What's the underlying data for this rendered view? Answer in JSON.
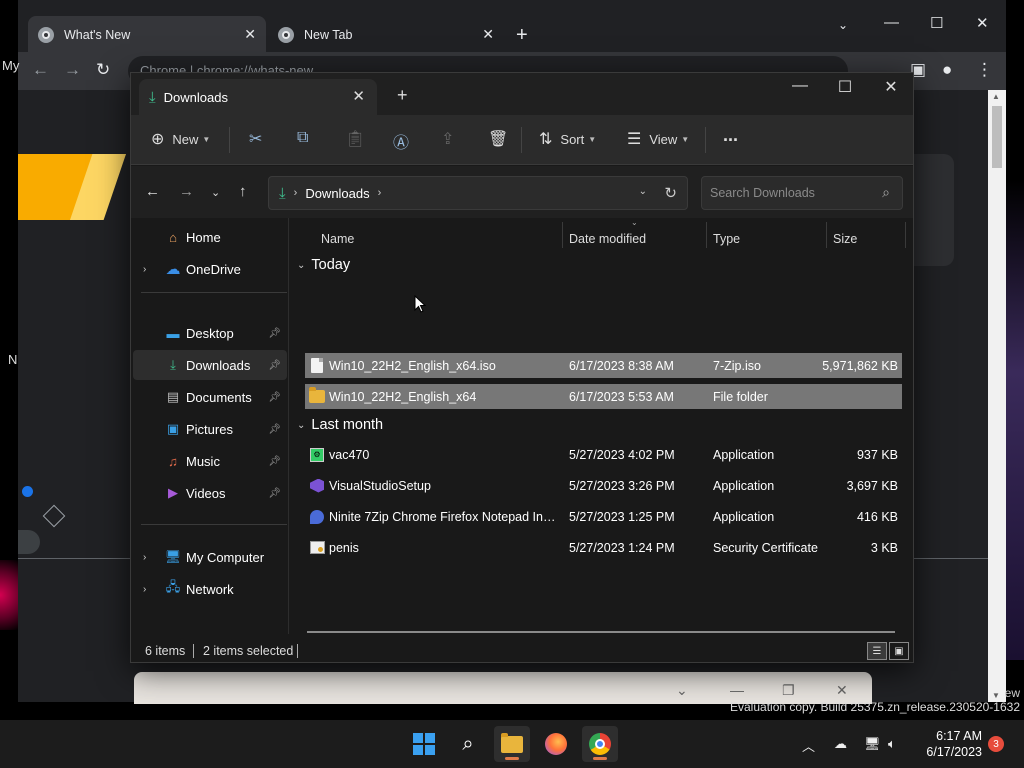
{
  "chrome": {
    "tabs": [
      {
        "label": "What's New"
      },
      {
        "label": "New Tab"
      }
    ],
    "omnibox": "Chrome  |  chrome://whats-new",
    "side_text_my": "My",
    "side_text_n": "N",
    "ew_text": "ew"
  },
  "explorer": {
    "tab_title": "Downloads",
    "commands": {
      "new": "New",
      "sort": "Sort",
      "view": "View",
      "more": "..."
    },
    "address": {
      "current": "Downloads"
    },
    "search_placeholder": "Search Downloads",
    "sidebar": [
      {
        "label": "Home",
        "icon": "home-icon"
      },
      {
        "label": "OneDrive",
        "icon": "onedrive-icon"
      },
      {
        "label": "Desktop",
        "icon": "desktop-icon"
      },
      {
        "label": "Downloads",
        "icon": "downloads-icon"
      },
      {
        "label": "Documents",
        "icon": "documents-icon"
      },
      {
        "label": "Pictures",
        "icon": "pictures-icon"
      },
      {
        "label": "Music",
        "icon": "music-icon"
      },
      {
        "label": "Videos",
        "icon": "videos-icon"
      },
      {
        "label": "My Computer",
        "icon": "computer-icon"
      },
      {
        "label": "Network",
        "icon": "network-icon"
      }
    ],
    "columns": {
      "name": "Name",
      "date": "Date modified",
      "type": "Type",
      "size": "Size"
    },
    "groups": [
      {
        "label": "Today",
        "rows": [
          {
            "name": "Win10_22H2_English_x64.iso",
            "date": "6/17/2023 8:38 AM",
            "type": "7-Zip.iso",
            "size": "5,971,862 KB",
            "icon": "iso-file-icon",
            "selected": true
          },
          {
            "name": "Win10_22H2_English_x64",
            "date": "6/17/2023 5:53 AM",
            "type": "File folder",
            "size": "",
            "icon": "folder-icon",
            "selected": true
          }
        ]
      },
      {
        "label": "Last month",
        "rows": [
          {
            "name": "vac470",
            "date": "5/27/2023 4:02 PM",
            "type": "Application",
            "size": "937 KB",
            "icon": "application-icon",
            "selected": false
          },
          {
            "name": "VisualStudioSetup",
            "date": "5/27/2023 3:26 PM",
            "type": "Application",
            "size": "3,697 KB",
            "icon": "visual-studio-icon",
            "selected": false
          },
          {
            "name": "Ninite 7Zip Chrome Firefox Notepad Inst...",
            "date": "5/27/2023 1:25 PM",
            "type": "Application",
            "size": "416 KB",
            "icon": "ninite-icon",
            "selected": false
          },
          {
            "name": "penis",
            "date": "5/27/2023 1:24 PM",
            "type": "Security Certificate",
            "size": "3 KB",
            "icon": "certificate-icon",
            "selected": false
          }
        ]
      }
    ],
    "status": {
      "items": "6 items",
      "selected": "2 items selected"
    }
  },
  "watermark": "Evaluation copy. Build 25375.zn_release.230520-1632",
  "taskbar": {
    "time": "6:17 AM",
    "date": "6/17/2023",
    "notification_count": "3"
  }
}
